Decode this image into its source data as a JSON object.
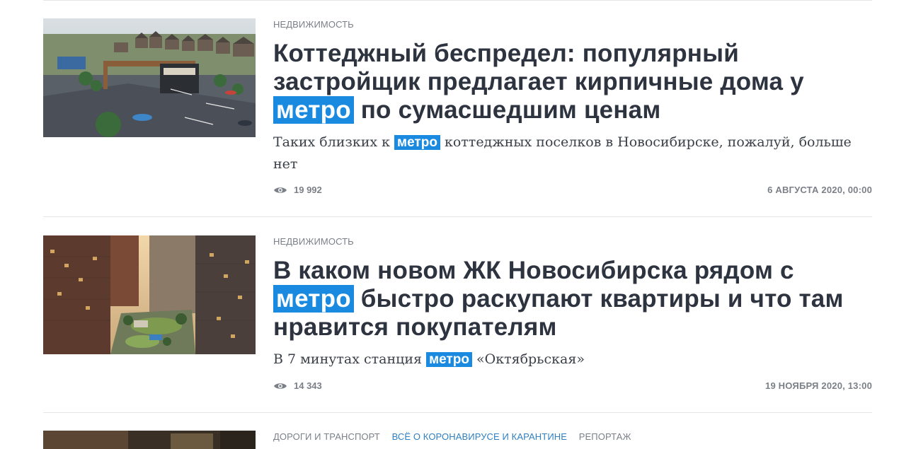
{
  "articles": [
    {
      "rubrics": [
        "Недвижимость"
      ],
      "title_parts": [
        "Коттеджный беспредел: популярный застройщик предлагает кирпичные дома у ",
        "метро",
        " по сумасшедшим ценам"
      ],
      "lead_parts": [
        "Таких близких к ",
        "метро",
        " коттеджных поселков в Новосибирске, пожалуй, больше нет"
      ],
      "views": "19 992",
      "date": "6 августа 2020, 00:00",
      "image": "cottage-village-rendering"
    },
    {
      "rubrics": [
        "Недвижимость"
      ],
      "title_parts": [
        "В каком новом ЖК Новосибирска рядом с ",
        "метро",
        " быстро раскупают квартиры и что там нравится покупателям"
      ],
      "lead_parts": [
        "В 7 минутах станция ",
        "метро",
        " «Октябрьская»"
      ],
      "views": "14 343",
      "date": "19 ноября 2020, 13:00",
      "image": "residential-complex-rendering"
    },
    {
      "rubrics": [
        "Дороги и транспорт",
        "Всё о коронавирусе и карантине",
        "Репортаж"
      ],
      "image": "road-photo"
    }
  ],
  "colors": {
    "highlight": "#1a8ae0",
    "accent_rubric": "#2f7fc1",
    "meta": "#7b8088",
    "title": "#2e3340"
  },
  "icons": {
    "views": "eye-icon"
  }
}
